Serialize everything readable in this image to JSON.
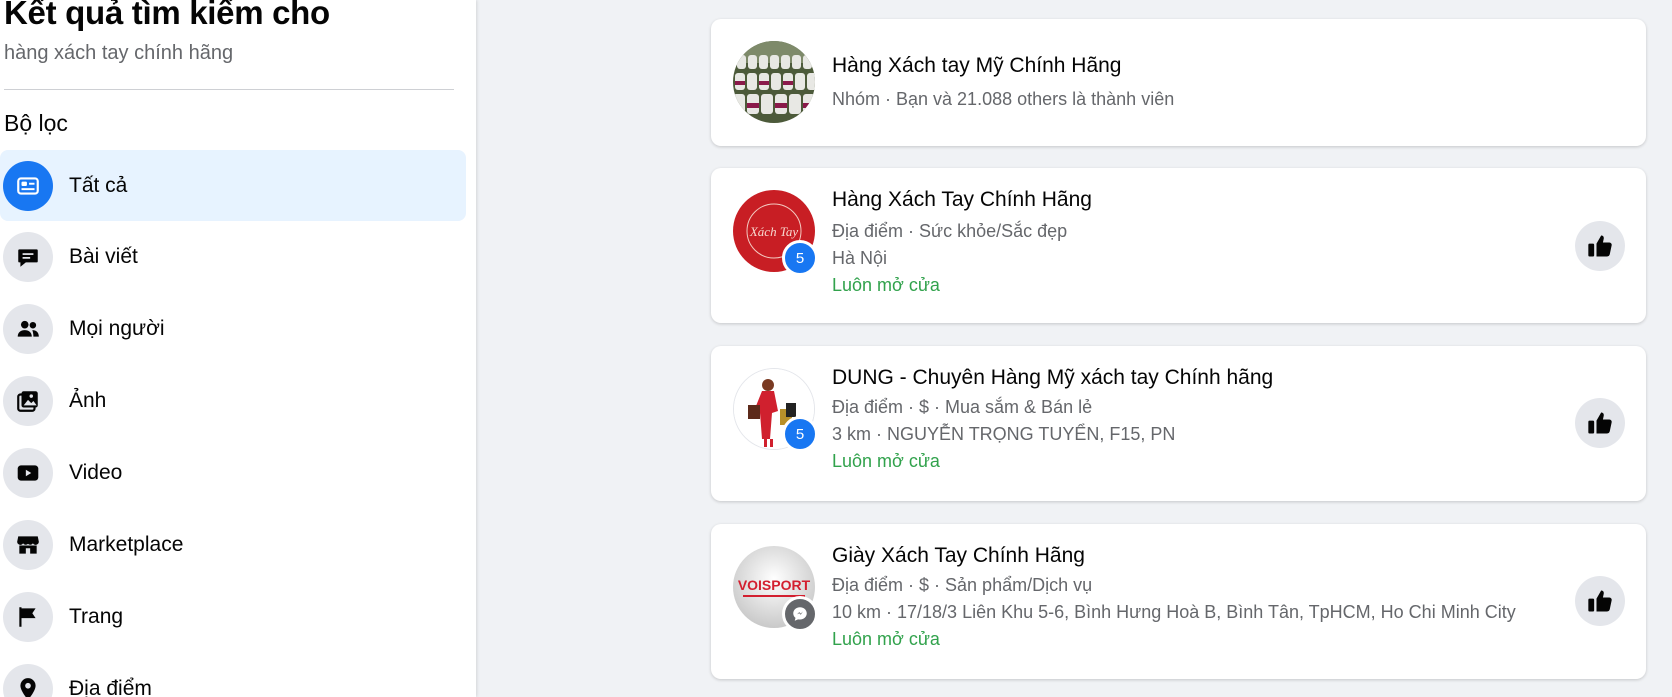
{
  "sidebar": {
    "title": "Kết quả tìm kiếm cho",
    "query": "hàng xách tay chính hãng",
    "filter_heading": "Bộ lọc",
    "items": [
      {
        "label": "Tất cả",
        "icon": "feed-icon",
        "active": true
      },
      {
        "label": "Bài viết",
        "icon": "post-icon"
      },
      {
        "label": "Mọi người",
        "icon": "people-icon"
      },
      {
        "label": "Ảnh",
        "icon": "photo-icon"
      },
      {
        "label": "Video",
        "icon": "video-icon"
      },
      {
        "label": "Marketplace",
        "icon": "shop-icon"
      },
      {
        "label": "Trang",
        "icon": "flag-icon"
      },
      {
        "label": "Địa điểm",
        "icon": "location-pin-icon"
      }
    ]
  },
  "results": [
    {
      "title": "Hàng Xách tay Mỹ Chính Hãng",
      "meta": "Nhóm · Bạn và 21.088 others là thành viên"
    },
    {
      "title": "Hàng Xách Tay Chính Hãng",
      "meta": "Địa điểm · Sức khỏe/Sắc đẹp",
      "location": "Hà Nội",
      "status": "Luôn mở cửa",
      "badge": "5",
      "avatar_text": "Xách Tay"
    },
    {
      "title": "DUNG - Chuyên Hàng Mỹ xách tay Chính hãng",
      "meta": "Địa điểm · $ · Mua sắm & Bán lẻ",
      "location": "3 km · NGUYỄN TRỌNG TUYỂN, F15, PN",
      "status": "Luôn mở cửa",
      "badge": "5"
    },
    {
      "title": "Giày Xách Tay Chính Hãng",
      "meta": "Địa điểm · $ · Sản phẩm/Dịch vụ",
      "location": "10 km · 17/18/3 Liên Khu 5-6, Bình Hưng Hoà B, Bình Tân, TpHCM, Ho Chi Minh City",
      "status": "Luôn mở cửa",
      "avatar_text": "VOISPORT"
    }
  ],
  "colors": {
    "accent": "#1877f2",
    "open_status": "#31a24c",
    "secondary_text": "#65676b"
  }
}
